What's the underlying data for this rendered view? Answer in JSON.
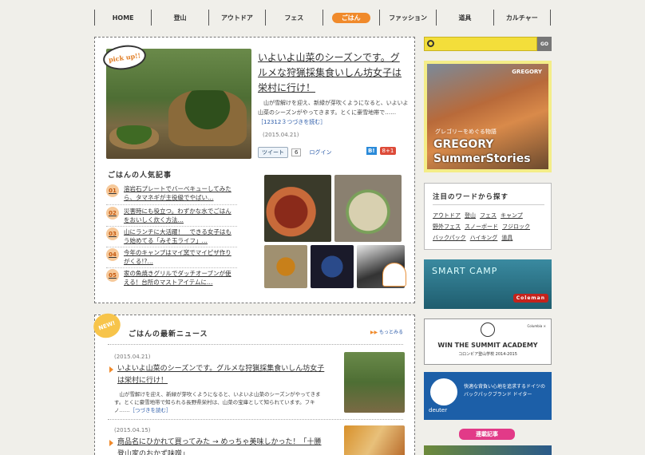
{
  "nav": {
    "items": [
      "HOME",
      "登山",
      "アウトドア",
      "フェス",
      "ごはん",
      "ファッション",
      "道具",
      "カルチャー"
    ],
    "active_index": 4
  },
  "pickup": {
    "badge": "pick up!!",
    "title": "いよいよ山菜のシーズンです。グルメな狩猟採集食いしん坊女子は栄村に行け！",
    "desc": "山が雪解けを迎え、新緑が芽吹くようになると、いよいよ山菜のシーズンがやってきます。とくに豪雪地帯で……",
    "more": "［12312３つづきを読む］",
    "date": "(2015.04.21)",
    "tweet": "ツイート",
    "tweet_count": "6",
    "login": "ログイン",
    "hatena": "B!",
    "gplus": "8+1"
  },
  "ranking": {
    "title": "ごはんの人気記事",
    "items": [
      {
        "num": "01",
        "text": "溶岩石プレートでバーベキューしてみたら、タマネギが主役級でやばい…"
      },
      {
        "num": "02",
        "text": "災害時にも役立つ。わずかな水でごはんをおいしく炊く方法…"
      },
      {
        "num": "03",
        "text": "山にランチに大活躍！　できる女子はもう始めてる「みそ玉ライフ」…"
      },
      {
        "num": "04",
        "text": "今年のキャンプはマイ窯でマイピザ作りがくる!?…"
      },
      {
        "num": "05",
        "text": "家の魚焼きグリルでダッチオーブンが使える！台所のマストアイテムに…"
      }
    ]
  },
  "news": {
    "badge": "NEW!",
    "title": "ごはんの最新ニュース",
    "more": "もっとみる",
    "items": [
      {
        "date": "(2015.04.21)",
        "title": "いよいよ山菜のシーズンです。グルメな狩猟採集食いしん坊女子は栄村に行け！",
        "body": "山が雪解けを迎え、新緑が芽吹くようになると、いよいよ山菜のシーズンがやってきます。とくに豪雪地帯で知られる長野県栄村は、山菜の宝庫として知られています。フキノ……",
        "more": "［つづきを読む］"
      },
      {
        "date": "(2015.04.15)",
        "title": "商品名にひかれて買ってみた → めっちゃ美味しかった！「十勝登山家のおかず味噌」"
      }
    ]
  },
  "search": {
    "placeholder": "",
    "go": "GO"
  },
  "gregory": {
    "logo": "GREGORY",
    "sub": "グレゴリーをめぐる物語",
    "big1": "GREGORY",
    "big2": "SummerStories"
  },
  "words": {
    "title": "注目のワードから探す",
    "tags": [
      "アウトドア",
      "登山",
      "フェス",
      "キャンプ",
      "野外フェス",
      "スノーボード",
      "フジロック",
      "バックパック",
      "ハイキング",
      "道具"
    ]
  },
  "smart": {
    "title": "SMART CAMP",
    "brand": "Coleman"
  },
  "summit": {
    "title": "WIN THE SUMMIT ACADEMY",
    "sub": "コロンビア登山学校 2014-2015",
    "corner": "Columbia × "
  },
  "deuter": {
    "brand": "deuter",
    "text": "快適な背負い心地を追求するドイツのバックパックブランド ドイター"
  },
  "series": {
    "label": "連載記事"
  },
  "colors": {
    "accent": "#f08a2b",
    "search": "#f3de3a"
  }
}
